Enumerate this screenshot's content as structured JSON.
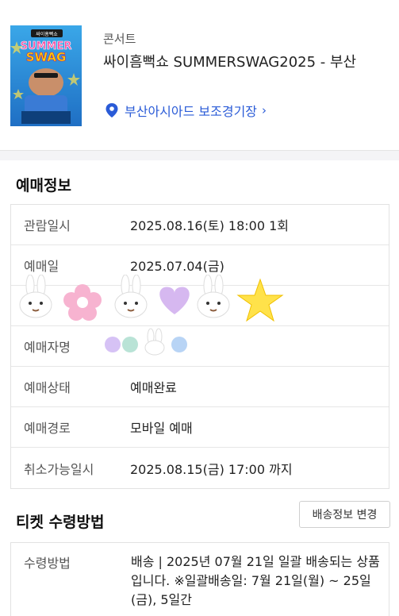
{
  "event": {
    "category": "콘서트",
    "title": "싸이흠뻑쇼 SUMMERSWAG2025 - 부산",
    "venue": "부산아시아드 보조경기장",
    "venue_chevron": "›",
    "poster": {
      "badge": "싸이흠뻑쇼",
      "line1": "SUMMER",
      "line2": "SWAG"
    }
  },
  "booking_info": {
    "title": "예매정보",
    "rows": [
      {
        "label": "관람일시",
        "value": "2025.08.16(토) 18:00 1회"
      },
      {
        "label": "예매일",
        "value": "2025.07.04(금)"
      },
      {
        "label": "",
        "value": ""
      },
      {
        "label": "예매자명",
        "value": ""
      },
      {
        "label": "예매상태",
        "value": "예매완료"
      },
      {
        "label": "예매경로",
        "value": "모바일 예매"
      },
      {
        "label": "취소가능일시",
        "value": "2025.08.15(금) 17:00 까지"
      }
    ]
  },
  "ticket_receive": {
    "title": "티켓 수령방법",
    "change_button": "배송정보 변경",
    "label": "수령방법",
    "value": "배송 | 2025년 07월 21일 일괄 배송되는 상품입니다. ※일괄배송일: 7월 21일(월) ~ 25일(금), 5일간"
  },
  "colors": {
    "accent_blue": "#2a5bd7",
    "divider": "#f4f4f6"
  }
}
